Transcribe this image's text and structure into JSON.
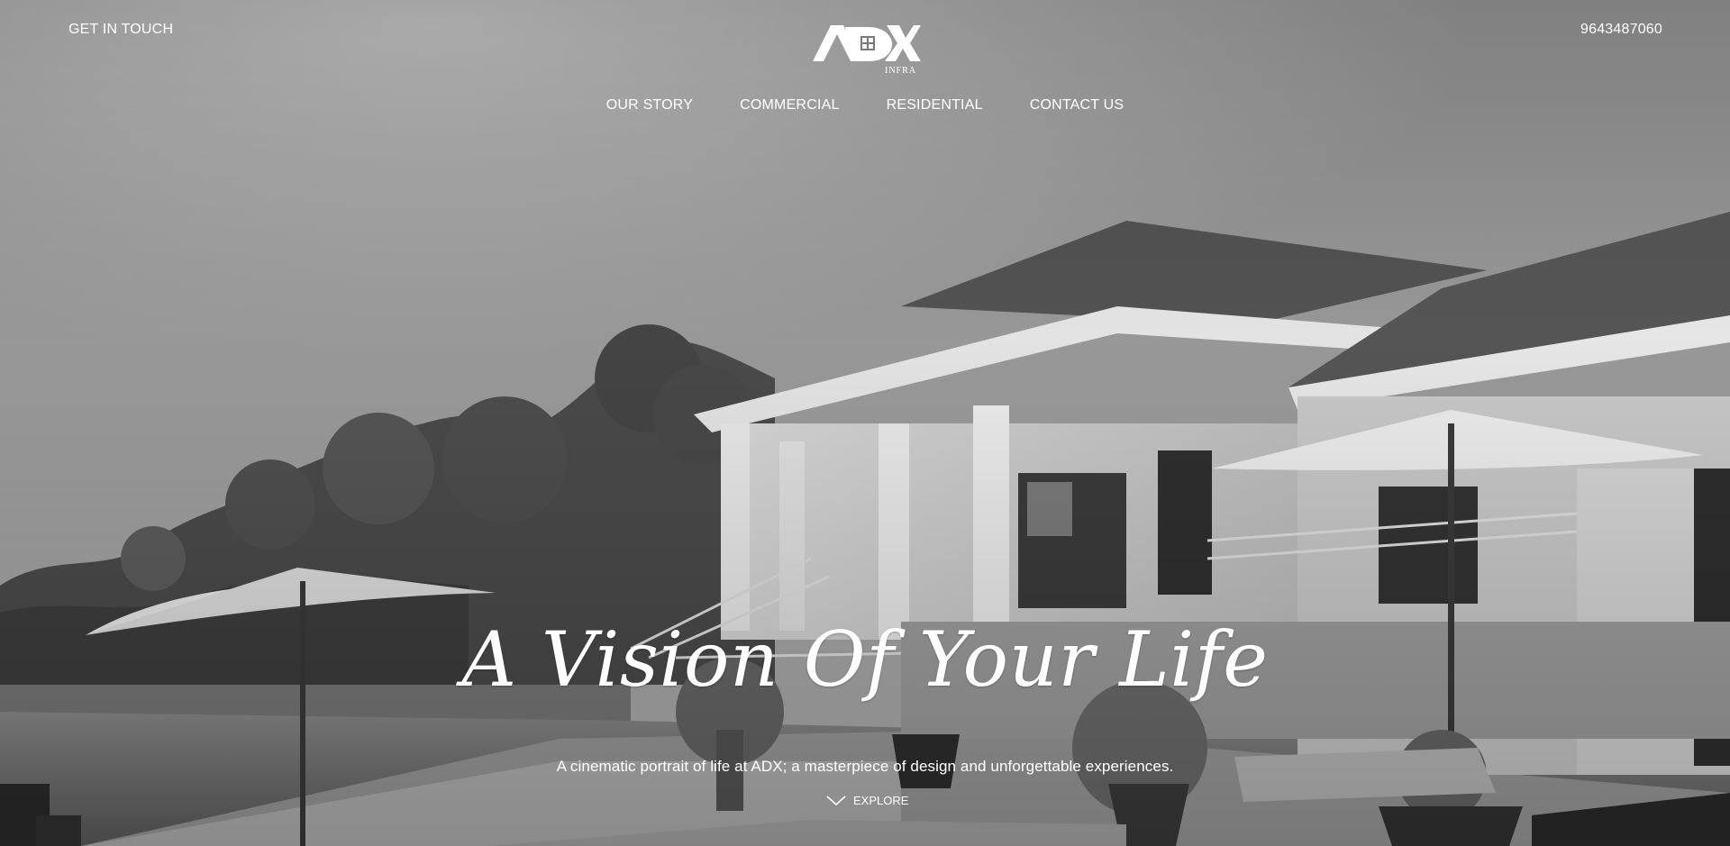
{
  "header": {
    "get_in_touch": "GET IN TOUCH",
    "phone": "9643487060",
    "logo_text": "ADX",
    "logo_sub": "INFRA"
  },
  "nav": {
    "items": [
      {
        "label": "OUR STORY"
      },
      {
        "label": "COMMERCIAL"
      },
      {
        "label": "RESIDENTIAL"
      },
      {
        "label": "CONTACT US"
      }
    ]
  },
  "hero": {
    "title": "A Vision Of Your Life",
    "subtitle": "A cinematic portrait of life at ADX; a masterpiece of design and unforgettable experiences.",
    "explore_label": "EXPLORE",
    "explore_icon": "chevron-down-icon"
  }
}
